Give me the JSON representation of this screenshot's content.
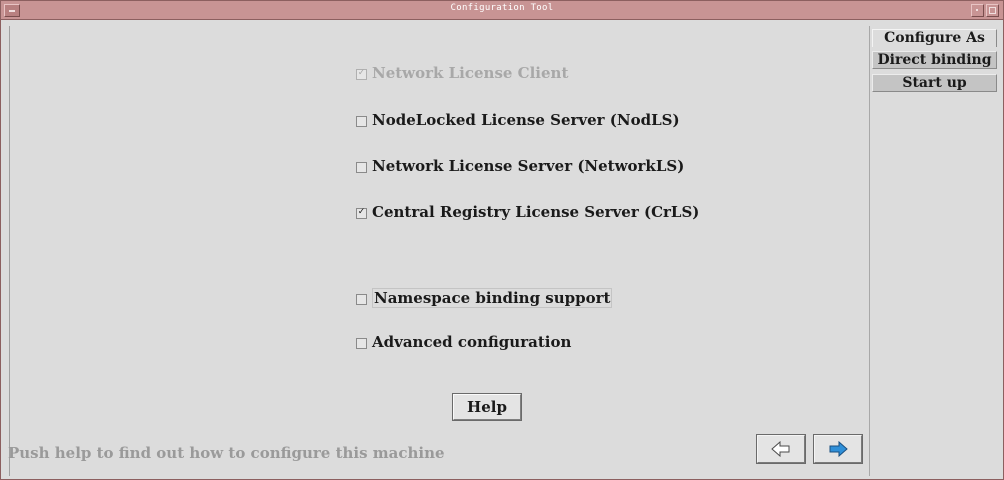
{
  "window": {
    "title": "Configuration Tool"
  },
  "options": {
    "network_client": {
      "label": "Network License Client",
      "checked": true,
      "enabled": false
    },
    "nodlocked": {
      "label": "NodeLocked License Server (NodLS)",
      "checked": false,
      "enabled": true
    },
    "network_server": {
      "label": "Network License Server (NetworkLS)",
      "checked": false,
      "enabled": true
    },
    "central_registry": {
      "label": "Central Registry License Server (CrLS)",
      "checked": true,
      "enabled": true
    },
    "namespace": {
      "label": "Namespace binding support",
      "checked": false,
      "enabled": true
    },
    "advanced": {
      "label": "Advanced configuration",
      "checked": false,
      "enabled": true
    }
  },
  "buttons": {
    "help": "Help"
  },
  "status": {
    "message": "Push help to find out how to configure this machine"
  },
  "tabs": [
    {
      "label": "Configure As",
      "active": true
    },
    {
      "label": "Direct binding",
      "active": false
    },
    {
      "label": "Start up",
      "active": false
    }
  ],
  "icons": {
    "back": "left-arrow-icon",
    "next": "right-arrow-icon"
  },
  "colors": {
    "titlebar": "#c89494",
    "background": "#dcdcdc",
    "next_arrow": "#2f8fd8",
    "disabled_text": "#a8a8a8"
  }
}
